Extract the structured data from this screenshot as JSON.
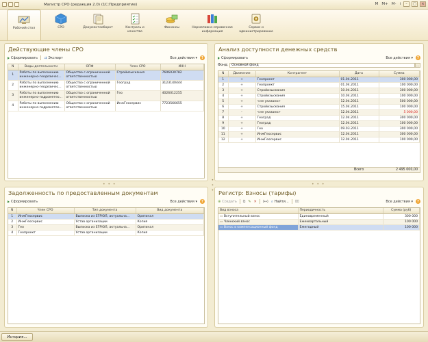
{
  "window": {
    "title": "Магистр СРО (редакция 2.0) (1С:Предприятие)",
    "right_controls": [
      "M",
      "M+",
      "M-",
      "i"
    ]
  },
  "sections": [
    {
      "label": "Рабочий стол",
      "icon": "desktop-icon"
    },
    {
      "label": "СРО",
      "icon": "cube-icon"
    },
    {
      "label": "Документооборот",
      "icon": "documents-icon"
    },
    {
      "label": "Контроль и качество",
      "icon": "checklist-icon"
    },
    {
      "label": "Финансы",
      "icon": "money-icon"
    },
    {
      "label": "Нормативно-справочная информация",
      "icon": "books-icon"
    },
    {
      "label": "Сервис и администрирование",
      "icon": "service-icon"
    }
  ],
  "members_panel": {
    "title": "Действующие члены СРО",
    "toolbar": {
      "generate": "Сформировать",
      "export": "Экспорт",
      "all_actions": "Все действия"
    },
    "columns": [
      "N",
      "Виды деятельности",
      "ОПФ",
      "Член СРО",
      "ИНН"
    ],
    "rows": [
      {
        "n": "1",
        "activity": "Работы по выполнению инженерно-геодезичес...",
        "opf": "Общество с ограниченной ответственностью",
        "member": "Стройизыскания",
        "inn": "7606030782"
      },
      {
        "n": "2",
        "activity": "Работы по выполнению инженерно-геодезичес...",
        "opf": "Общество с ограниченной ответственностью",
        "member": "Геоград",
        "inn": "3123140444"
      },
      {
        "n": "3",
        "activity": "Работы по выполнению инженерно-гидрометео...",
        "opf": "Общество с ограниченной ответственностью",
        "member": "Гео",
        "inn": "4026012255"
      },
      {
        "n": "4",
        "activity": "Работы по выполнению инженерно-гидрометео...",
        "opf": "Общество с ограниченной ответственностью",
        "member": "ИнжГеосервис",
        "inn": "7723566655"
      }
    ]
  },
  "funds_panel": {
    "title": "Анализ доступности денежных средств",
    "toolbar": {
      "generate": "Сформировать",
      "all_actions": "Все действия"
    },
    "filter": {
      "label": "Фонд:",
      "value": "Основной фонд"
    },
    "columns": [
      "N",
      "Движение",
      "Контрагент",
      "Дата",
      "Сумма"
    ],
    "rows": [
      {
        "n": "1",
        "move": "+",
        "party": "Геопроект",
        "date": "01.04.2011",
        "sum": "300 000,00"
      },
      {
        "n": "2",
        "move": "+",
        "party": "Геопроект",
        "date": "01.04.2011",
        "sum": "100 000,00"
      },
      {
        "n": "3",
        "move": "+",
        "party": "Стройизыскания",
        "date": "10.04.2011",
        "sum": "300 000,00"
      },
      {
        "n": "4",
        "move": "+",
        "party": "Стройизыскания",
        "date": "10.04.2011",
        "sum": "100 000,00"
      },
      {
        "n": "5",
        "move": "+",
        "party": "<не указано>",
        "date": "12.04.2011",
        "sum": "500 000,00"
      },
      {
        "n": "6",
        "move": "+",
        "party": "Стройизыскания",
        "date": "15.04.2011",
        "sum": "100 000,00"
      },
      {
        "n": "7",
        "move": "-",
        "party": "<не указано>",
        "date": "12.04.2011",
        "sum": "5 000,00"
      },
      {
        "n": "8",
        "move": "+",
        "party": "Геоград",
        "date": "12.04.2011",
        "sum": "300 000,00"
      },
      {
        "n": "9",
        "move": "+",
        "party": "Геоград",
        "date": "12.04.2011",
        "sum": "100 000,00"
      },
      {
        "n": "10",
        "move": "+",
        "party": "Гео",
        "date": "09.03.2011",
        "sum": "300 000,00"
      },
      {
        "n": "11",
        "move": "+",
        "party": "ИнжГеосервис",
        "date": "12.04.2011",
        "sum": "300 000,00"
      },
      {
        "n": "12",
        "move": "+",
        "party": "ИнжГеосервис",
        "date": "12.04.2011",
        "sum": "100 000,00"
      }
    ],
    "total_label": "Всего",
    "total_value": "2 495 000,00"
  },
  "debt_panel": {
    "title": "Задолженность по предоставленным документам",
    "toolbar": {
      "generate": "Сформировать",
      "all_actions": "Все действия"
    },
    "columns": [
      "N",
      "Член СРО",
      "Тип документа",
      "Вид документа"
    ],
    "rows": [
      {
        "n": "1",
        "member": "ИнжГеосервис",
        "doc_type": "Выписка из ЕГРЮЛ, актуальна...",
        "doc_kind": "Оригинал"
      },
      {
        "n": "2",
        "member": "ИнжГеосервис",
        "doc_type": "Устав организации",
        "doc_kind": "Копия"
      },
      {
        "n": "3",
        "member": "Гео",
        "doc_type": "Выписка из ЕГРЮЛ, актуальна...",
        "doc_kind": "Оригинал"
      },
      {
        "n": "4",
        "member": "Геопроект",
        "doc_type": "Устав организации",
        "doc_kind": "Копия"
      }
    ]
  },
  "fees_panel": {
    "title": "Регистр: Взносы (тарифы)",
    "toolbar": {
      "create": "Создать",
      "find": "Найти...",
      "all_actions": "Все действия"
    },
    "columns": [
      "Вид взноса",
      "Периодичность",
      "Сумма (руб)"
    ],
    "rows": [
      {
        "kind": "Вступительный взнос",
        "period": "Единовременный",
        "sum": "300 000"
      },
      {
        "kind": "Членский взнос",
        "period": "Ежеквартальный",
        "sum": "100 000"
      },
      {
        "kind": "Взнос в компенсационный фонд",
        "period": "Ежегодный",
        "sum": "100 000"
      }
    ]
  },
  "taskbar": {
    "history": "История..."
  }
}
